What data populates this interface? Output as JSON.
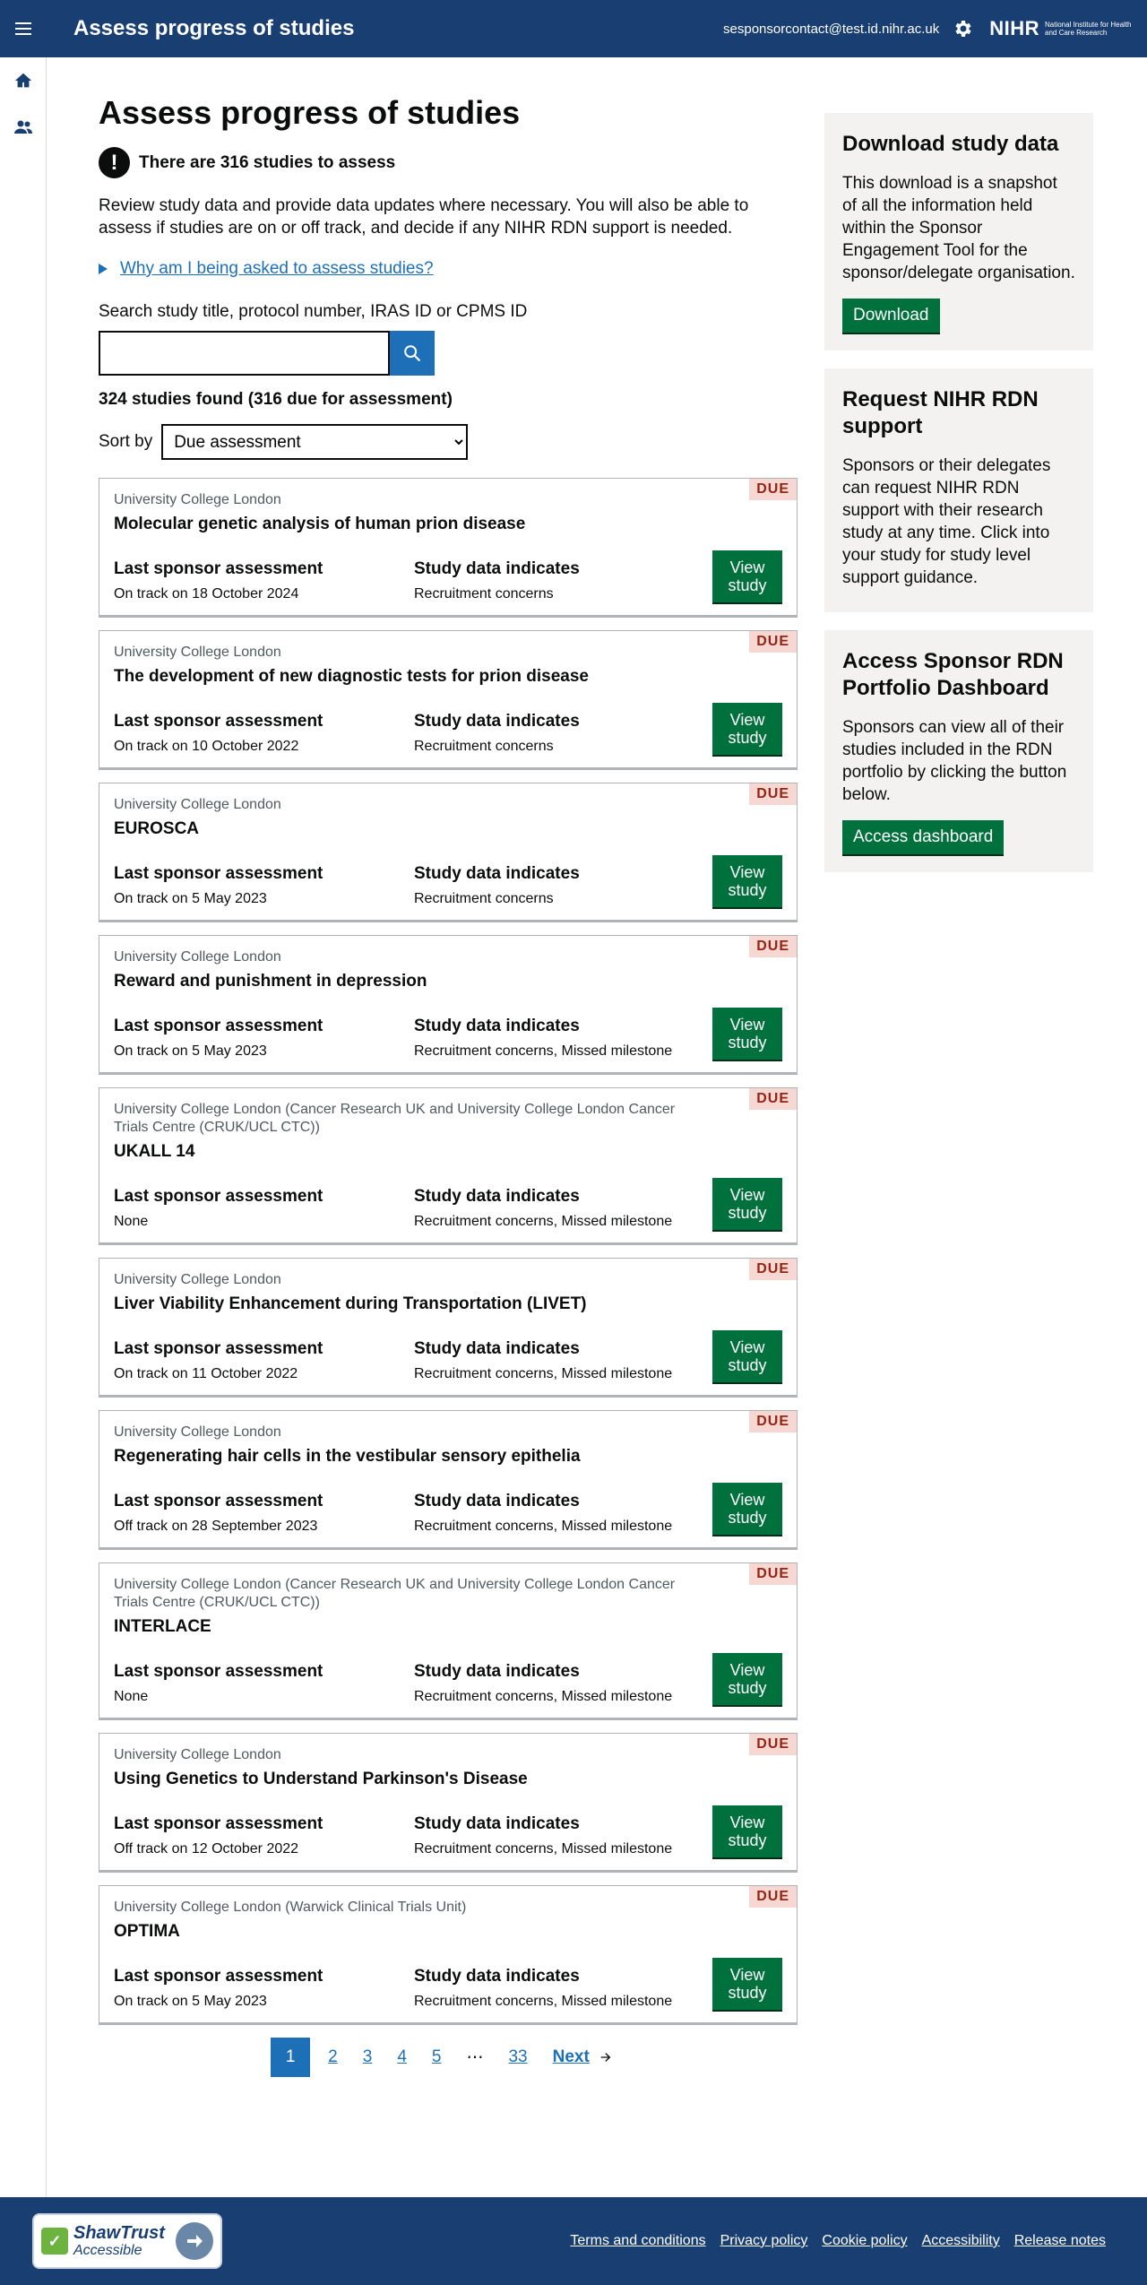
{
  "header": {
    "title": "Assess progress of studies",
    "user_email": "sesponsorcontact@test.id.nihr.ac.uk",
    "logo_text": "NIHR",
    "logo_subtitle": "National Institute for Health and Care Research",
    "bg_color": "#193e72"
  },
  "rail": {
    "items": [
      {
        "icon": "home-icon"
      },
      {
        "icon": "users-icon"
      }
    ]
  },
  "main": {
    "title": "Assess progress of studies",
    "warning": "There are 316 studies to assess",
    "intro": "Review study data and provide data updates where necessary. You will also be able to assess if studies are on or off track, and decide if any NIHR RDN support is needed.",
    "details_summary": "Why am I being asked to assess studies?",
    "search_label": "Search study title, protocol number, IRAS ID or CPMS ID",
    "search_value": "",
    "results": "324 studies found (316 due for assessment)",
    "sort_label": "Sort by",
    "sort_value": "Due assessment"
  },
  "card_labels": {
    "due": "DUE",
    "last_assessment": "Last sponsor assessment",
    "study_data": "Study data indicates",
    "view_line1": "View",
    "view_line2": "study"
  },
  "studies": [
    {
      "org": "University College London",
      "title": "Molecular genetic analysis of human prion disease",
      "last": "On track on 18 October 2024",
      "data": "Recruitment concerns"
    },
    {
      "org": "University College London",
      "title": "The development of new diagnostic tests for prion disease",
      "last": "On track on 10 October 2022",
      "data": "Recruitment concerns"
    },
    {
      "org": "University College London",
      "title": "EUROSCA",
      "last": "On track on 5 May 2023",
      "data": "Recruitment concerns"
    },
    {
      "org": "University College London",
      "title": "Reward and punishment in depression",
      "last": "On track on 5 May 2023",
      "data": "Recruitment concerns, Missed milestone"
    },
    {
      "org": "University College London (Cancer Research UK and University College London Cancer Trials Centre (CRUK/UCL CTC))",
      "title": "UKALL 14",
      "last": "None",
      "data": "Recruitment concerns, Missed milestone"
    },
    {
      "org": "University College London",
      "title": "Liver Viability Enhancement during Transportation (LIVET)",
      "last": "On track on 11 October 2022",
      "data": "Recruitment concerns, Missed milestone"
    },
    {
      "org": "University College London",
      "title": "Regenerating hair cells in the vestibular sensory epithelia",
      "last": "Off track on 28 September 2023",
      "data": "Recruitment concerns, Missed milestone"
    },
    {
      "org": "University College London (Cancer Research UK and University College London Cancer Trials Centre (CRUK/UCL CTC))",
      "title": "INTERLACE",
      "last": "None",
      "data": "Recruitment concerns, Missed milestone"
    },
    {
      "org": "University College London",
      "title": "Using Genetics to Understand Parkinson's Disease",
      "last": "Off track on 12 October 2022",
      "data": "Recruitment concerns, Missed milestone"
    },
    {
      "org": "University College London (Warwick Clinical Trials Unit)",
      "title": "OPTIMA",
      "last": "On track on 5 May 2023",
      "data": "Recruitment concerns, Missed milestone"
    }
  ],
  "pagination": {
    "pages": [
      "1",
      "2",
      "3",
      "4",
      "5"
    ],
    "current": "1",
    "ellipsis": "⋯",
    "last": "33",
    "next": "Next"
  },
  "sidebar": {
    "download": {
      "title": "Download study data",
      "text": "This download is a snapshot of all the information held within the Sponsor Engagement Tool for the sponsor/delegate organisation.",
      "button": "Download"
    },
    "request": {
      "title": "Request NIHR RDN support",
      "text": "Sponsors or their delegates can request NIHR RDN support with their research study at any time. Click into your study for study level support guidance."
    },
    "dashboard": {
      "title": "Access Sponsor RDN Portfolio Dashboard",
      "text": "Sponsors can view all of their studies included in the RDN portfolio by clicking the button below.",
      "button": "Access dashboard"
    }
  },
  "footer": {
    "badge_line1": "ShawTrust",
    "badge_line2": "Accessible",
    "links": [
      "Terms and conditions",
      "Privacy policy",
      "Cookie policy",
      "Accessibility",
      "Release notes"
    ]
  },
  "colors": {
    "brand": "#193e72",
    "link": "#1d70b8",
    "button": "#00703c",
    "due_bg": "#f6d7d2",
    "due_text": "#942514"
  }
}
